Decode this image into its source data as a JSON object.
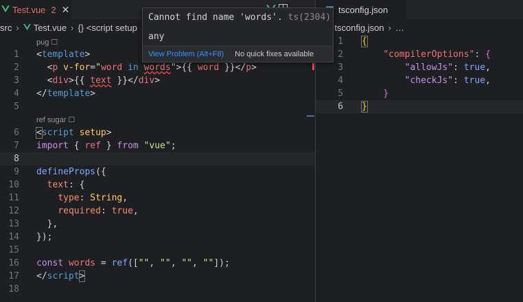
{
  "left_editor": {
    "tab": {
      "name": "Test.vue",
      "problems": "2",
      "close": "✕"
    },
    "breadcrumb": [
      "src",
      "Test.vue",
      "{} <script setup"
    ],
    "codelens": {
      "pug": "pug ☐",
      "ref_sugar": "ref sugar ☐"
    },
    "line_numbers": [
      "1",
      "2",
      "3",
      "4",
      "5",
      "6",
      "7",
      "8",
      "9",
      "10",
      "11",
      "12",
      "13",
      "14",
      "15",
      "16",
      "17",
      "18"
    ]
  },
  "right_editor": {
    "tab": {
      "name": "tsconfig.json"
    },
    "breadcrumb": [
      "tsconfig.json",
      "…"
    ],
    "line_numbers": [
      "1",
      "2",
      "3",
      "4",
      "5",
      "6"
    ]
  },
  "hover": {
    "message": "Cannot find name 'words'.",
    "code": "ts(2304)",
    "type": "any",
    "view_problem": "View Problem (Alt+F8)",
    "no_quick_fixes": "No quick fixes available"
  },
  "colors": {
    "background": "#1e1f22",
    "keyword": "#569cd6",
    "error": "#f14c4c",
    "link": "#3794ff",
    "vue": "#41b883",
    "json": "#519aba"
  }
}
